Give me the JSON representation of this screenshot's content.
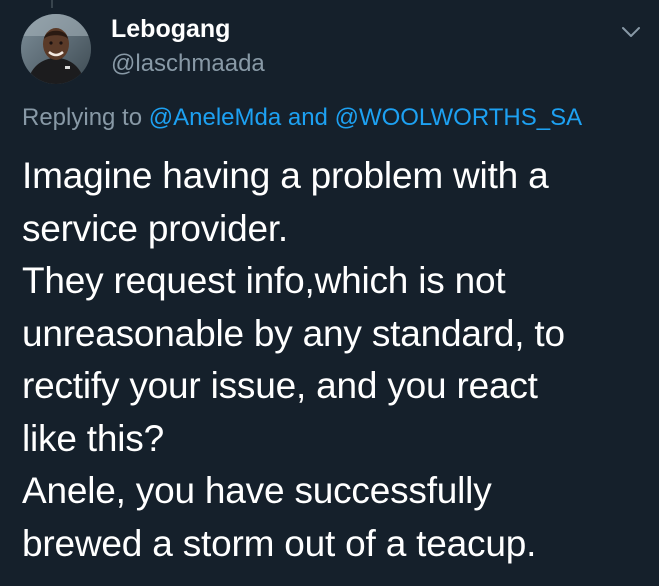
{
  "author": {
    "name": "Lebogang",
    "handle": "@laschmaada",
    "avatar_icon": "profile-photo"
  },
  "reply_context": {
    "prefix": "Replying to",
    "mentions": [
      "@AneleMda",
      "@WOOLWORTHS_SA"
    ],
    "joiner": "and"
  },
  "tweet": {
    "lines": [
      "Imagine having a problem with a",
      "service provider.",
      "They request info,which is not",
      "unreasonable by any standard, to",
      "rectify your issue, and you react",
      "like this?",
      "Anele, you have successfully",
      "brewed a storm out of a teacup."
    ]
  },
  "menu": {
    "icon": "chevron-down-icon"
  },
  "colors": {
    "background": "#15202b",
    "text_primary": "#ffffff",
    "text_secondary": "#8899a6",
    "link": "#1da1f2"
  }
}
